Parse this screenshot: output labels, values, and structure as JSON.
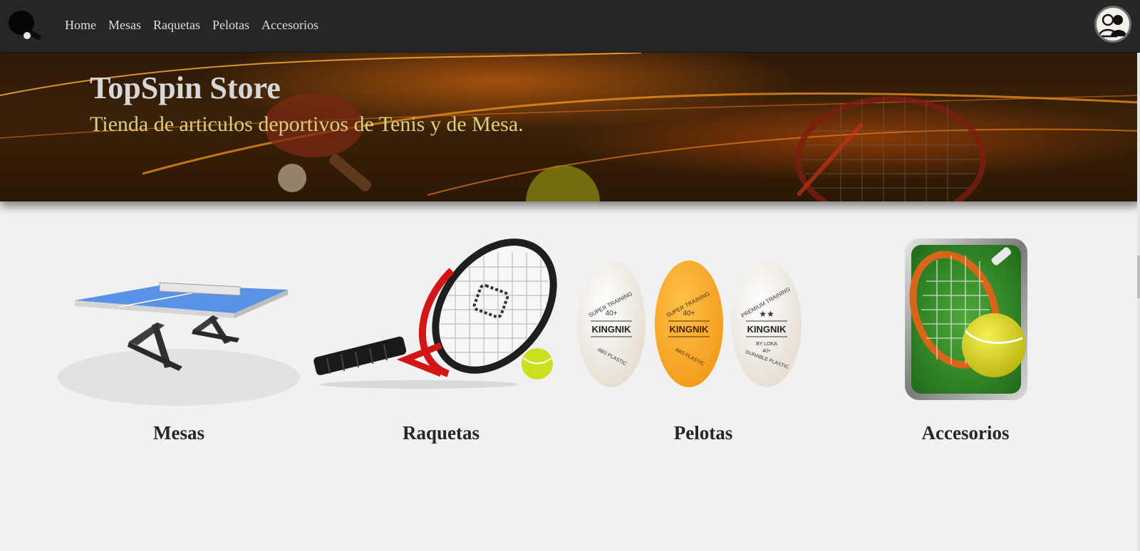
{
  "nav": {
    "items": [
      {
        "label": "Home"
      },
      {
        "label": "Mesas"
      },
      {
        "label": "Raquetas"
      },
      {
        "label": "Pelotas"
      },
      {
        "label": "Accesorios"
      }
    ]
  },
  "hero": {
    "title": "TopSpin Store",
    "subtitle": "Tienda de articulos deportivos de Tenis y de Mesa."
  },
  "categories": [
    {
      "label": "Mesas",
      "icon": "ping-pong-table-icon"
    },
    {
      "label": "Raquetas",
      "icon": "tennis-racket-icon"
    },
    {
      "label": "Pelotas",
      "icon": "ping-pong-balls-icon",
      "ball_texts": {
        "super_training": "SUPER TRAINING",
        "forty_plus": "40+",
        "brand": "KINGNIK",
        "abs_plastic": "ABS PLASTIC",
        "premium_training": "PREMIUM TRAINING",
        "by_loka": "BY LOKA",
        "durable_plastic": "DURABLE PLASTIC"
      }
    },
    {
      "label": "Accesorios",
      "icon": "tennis-app-icon"
    }
  ],
  "colors": {
    "navbar": "#262628",
    "hero_title": "#d7d7d7",
    "hero_subtitle": "#d6d17f",
    "page_background": "#f1f1f1"
  }
}
